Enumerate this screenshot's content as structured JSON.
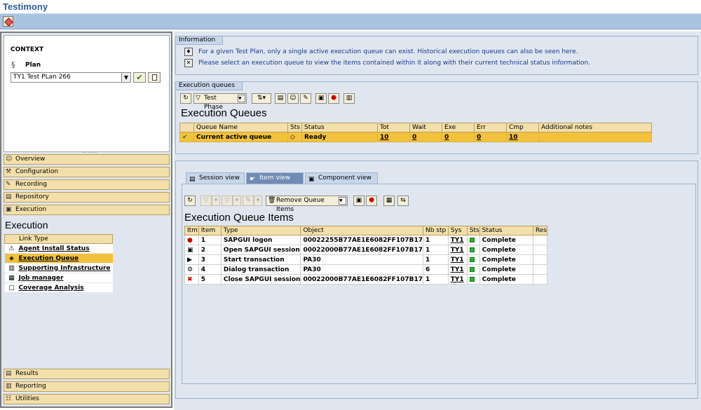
{
  "app": {
    "title": "Testimony"
  },
  "context": {
    "title": "CONTEXT",
    "plan_label": "Plan",
    "plan_value": "TY1 Test PLan 266",
    "plan_select_icon": "chevron-down-icon",
    "dots": "......"
  },
  "nav_top": [
    {
      "label": "Overview",
      "icon": "person-icon"
    },
    {
      "label": "Configuration",
      "icon": "wrench-icon"
    },
    {
      "label": "Recording",
      "icon": "pencil-icon"
    },
    {
      "label": "Repository",
      "icon": "repository-icon"
    },
    {
      "label": "Execution",
      "icon": "execution-icon"
    }
  ],
  "execution_section": {
    "title": "Execution",
    "link_header": "Link Type",
    "links": [
      {
        "label": "Agent Install Status",
        "icon": "agent-icon",
        "selected": false
      },
      {
        "label": "Execution Queue",
        "icon": "queue-icon",
        "selected": true
      },
      {
        "label": "Supporting Infrastructure",
        "icon": "infrastructure-icon",
        "selected": false
      },
      {
        "label": "Job manager",
        "icon": "job-icon",
        "selected": false
      },
      {
        "label": "Coverage Analysis",
        "icon": "coverage-icon",
        "selected": false
      }
    ]
  },
  "nav_bottom": [
    {
      "label": "Results",
      "icon": "results-icon"
    },
    {
      "label": "Reporting",
      "icon": "reporting-icon"
    },
    {
      "label": "Utilities",
      "icon": "utilities-icon"
    }
  ],
  "information": {
    "tab": "Information",
    "lines": [
      "For a given Test Plan, only a single active execution queue can exist. Historical execution queues can also be seen here.",
      "Please select an execution queue to view the items contained within it along with their current technical status information."
    ]
  },
  "queues": {
    "tab": "Execution queues",
    "test_phase_button": "Test Phase",
    "title": "Execution Queues",
    "columns": [
      "Queue Name",
      "Sts",
      "Status",
      "Tot",
      "Wait",
      "Exe",
      "Err",
      "Cmp",
      "Additional notes"
    ],
    "rows": [
      {
        "name": "Current active queue",
        "sts": "◇",
        "status": "Ready",
        "tot": "10",
        "wait": "0",
        "exe": "0",
        "err": "0",
        "cmp": "10",
        "notes": ""
      }
    ]
  },
  "tabs": [
    {
      "label": "Session view",
      "icon": "session-icon",
      "active": false
    },
    {
      "label": "Item view",
      "icon": "item-icon",
      "active": true
    },
    {
      "label": "Component view",
      "icon": "component-icon",
      "active": false
    }
  ],
  "items": {
    "remove_button": "Remove Queue Items",
    "title": "Execution Queue Items",
    "columns": [
      "Itm",
      "Item",
      "Type",
      "Object",
      "Nb stp",
      "Sys",
      "Sts",
      "Status",
      "Res"
    ],
    "rows": [
      {
        "icon": "logon-icon",
        "item": "1",
        "type": "SAPGUI logon",
        "object": "00022255B77AE1E6082FF107B17",
        "steps": "1",
        "sys": "TY1",
        "status": "Complete"
      },
      {
        "icon": "session-open-icon",
        "item": "2",
        "type": "Open SAPGUI session",
        "object": "00022000B77AE1E6082FF107B17",
        "steps": "1",
        "sys": "TY1",
        "status": "Complete"
      },
      {
        "icon": "play-icon",
        "item": "3",
        "type": "Start transaction",
        "object": "PA30",
        "steps": "1",
        "sys": "TY1",
        "status": "Complete"
      },
      {
        "icon": "dialog-icon",
        "item": "4",
        "type": "Dialog transaction",
        "object": "PA30",
        "steps": "6",
        "sys": "TY1",
        "status": "Complete"
      },
      {
        "icon": "close-session-icon",
        "item": "5",
        "type": "Close SAPGUI session",
        "object": "00022000B77AE1E6082FF107B17",
        "steps": "1",
        "sys": "TY1",
        "status": "Complete"
      }
    ]
  }
}
